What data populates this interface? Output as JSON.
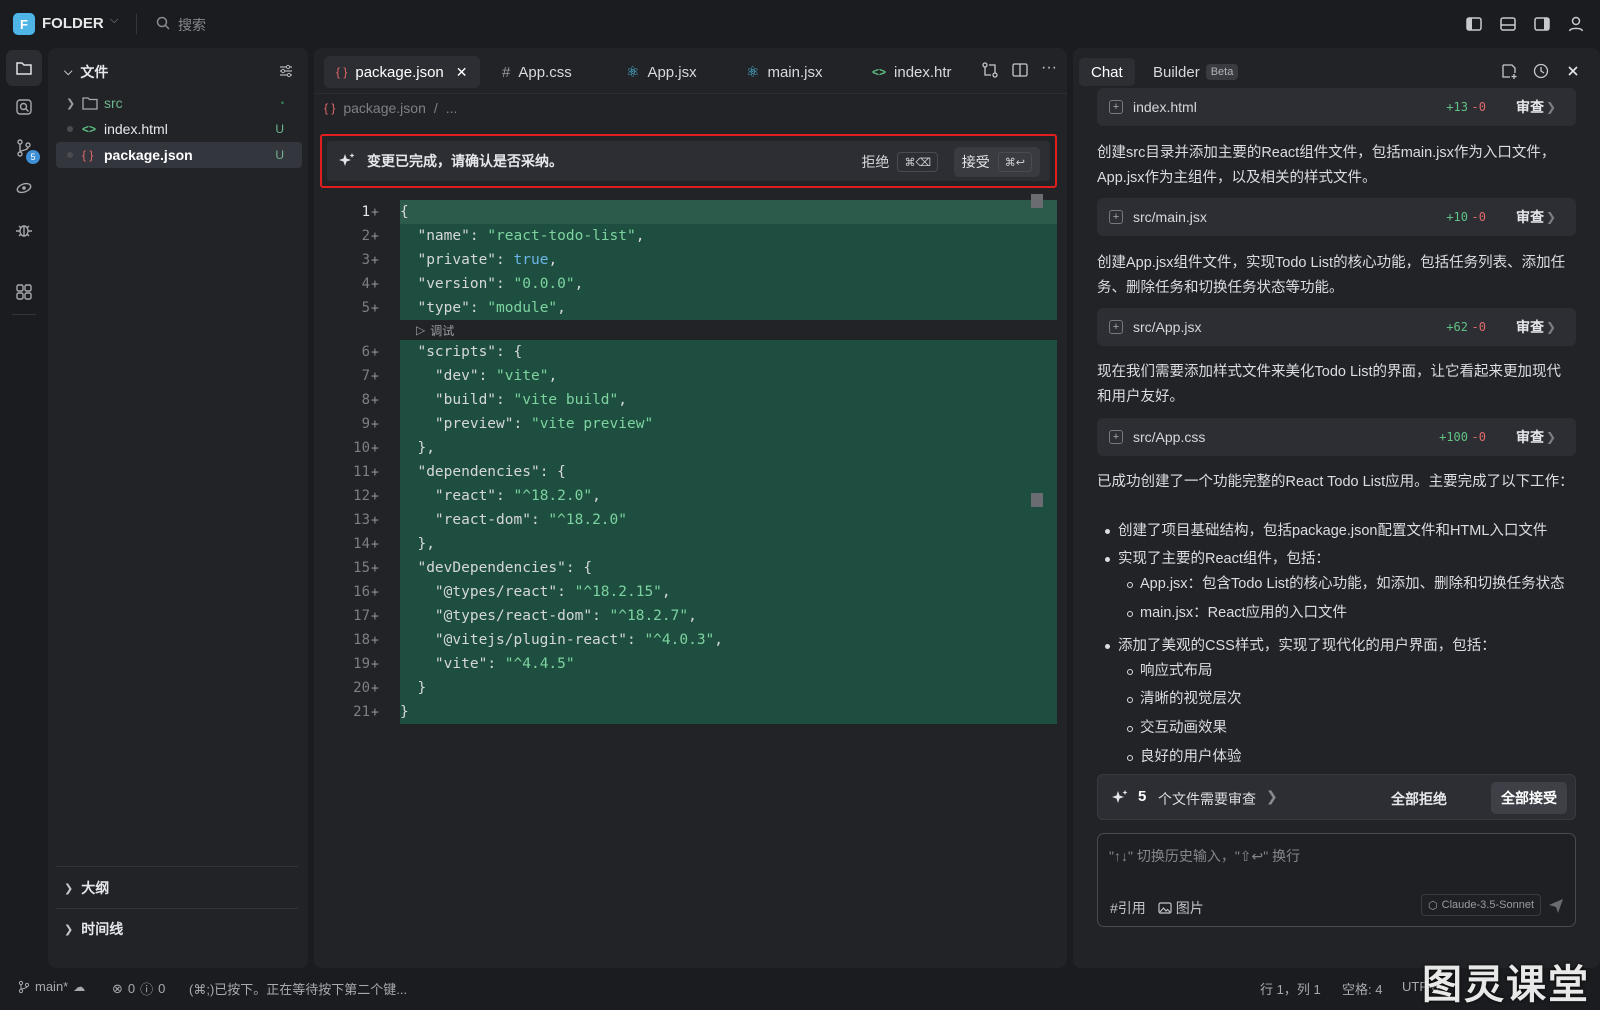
{
  "titlebar": {
    "logo_letter": "F",
    "app_name": "FOLDER",
    "search_placeholder": "搜索"
  },
  "activity": {
    "git_badge": "5"
  },
  "explorer": {
    "title": "文件",
    "items": [
      {
        "name": "src",
        "status": "•",
        "type": "folder"
      },
      {
        "name": "index.html",
        "status": "U",
        "type": "html"
      },
      {
        "name": "package.json",
        "status": "U",
        "type": "json"
      }
    ],
    "outline": "大纲",
    "timeline": "时间线"
  },
  "editor": {
    "tabs": [
      {
        "label": "package.json",
        "icon": "{ }"
      },
      {
        "label": "App.css",
        "icon": "#"
      },
      {
        "label": "App.jsx",
        "icon": "react"
      },
      {
        "label": "main.jsx",
        "icon": "react"
      },
      {
        "label": "index.htr",
        "icon": "<>"
      }
    ],
    "breadcrumb": {
      "file": "package.json",
      "sep": "/",
      "more": "..."
    },
    "banner": {
      "text": "变更已完成，请确认是否采纳。",
      "reject": "拒绝",
      "reject_kbd": "⌘⌫",
      "accept": "接受",
      "accept_kbd": "⌘↩"
    },
    "codelens": "调试",
    "lines": [
      "{",
      "  \"name\": \"react-todo-list\",",
      "  \"private\": true,",
      "  \"version\": \"0.0.0\",",
      "  \"type\": \"module\",",
      "  \"scripts\": {",
      "    \"dev\": \"vite\",",
      "    \"build\": \"vite build\",",
      "    \"preview\": \"vite preview\"",
      "  },",
      "  \"dependencies\": {",
      "    \"react\": \"^18.2.0\",",
      "    \"react-dom\": \"^18.2.0\"",
      "  },",
      "  \"devDependencies\": {",
      "    \"@types/react\": \"^18.2.15\",",
      "    \"@types/react-dom\": \"^18.2.7\",",
      "    \"@vitejs/plugin-react\": \"^4.0.3\",",
      "    \"vite\": \"^4.4.5\"",
      "  }",
      "}"
    ]
  },
  "chat": {
    "tab_chat": "Chat",
    "tab_builder": "Builder",
    "beta": "Beta",
    "cards": [
      {
        "file": "index.html",
        "add": "+13",
        "del": "-0",
        "review": "审查"
      },
      {
        "file": "src/main.jsx",
        "add": "+10",
        "del": "-0",
        "review": "审查"
      },
      {
        "file": "src/App.jsx",
        "add": "+62",
        "del": "-0",
        "review": "审查"
      },
      {
        "file": "src/App.css",
        "add": "+100",
        "del": "-0",
        "review": "审查"
      }
    ],
    "paras": [
      "创建src目录并添加主要的React组件文件，包括main.jsx作为入口文件，App.jsx作为主组件，以及相关的样式文件。",
      "创建App.jsx组件文件，实现Todo List的核心功能，包括任务列表、添加任务、删除任务和切换任务状态等功能。",
      "现在我们需要添加样式文件来美化Todo List的界面，让它看起来更加现代和用户友好。",
      "已成功创建了一个功能完整的React Todo List应用。主要完成了以下工作："
    ],
    "bullets": [
      "创建了项目基础结构，包括package.json配置文件和HTML入口文件",
      "实现了主要的React组件，包括：",
      "App.jsx：包含Todo List的核心功能，如添加、删除和切换任务状态",
      "main.jsx：React应用的入口文件",
      "添加了美观的CSS样式，实现了现代化的用户界面，包括：",
      "响应式布局",
      "清晰的视觉层次",
      "交互动画效果",
      "良好的用户体验"
    ],
    "review_bar": {
      "count": "5",
      "text": "个文件需要审查",
      "reject_all": "全部拒绝",
      "accept_all": "全部接受"
    },
    "input": {
      "placeholder": "\"↑↓\" 切换历史输入，\"⇧↩\" 换行",
      "ref": "引用",
      "image": "图片",
      "model": "Claude-3.5-Sonnet"
    }
  },
  "statusbar": {
    "branch": "main*",
    "errors": "0",
    "warnings": "0",
    "message": "(⌘;)已按下。正在等待按下第二个键...",
    "position": "行 1，列 1",
    "spaces": "空格: 4",
    "encoding": "UTF-8"
  },
  "watermark": "图灵课堂"
}
